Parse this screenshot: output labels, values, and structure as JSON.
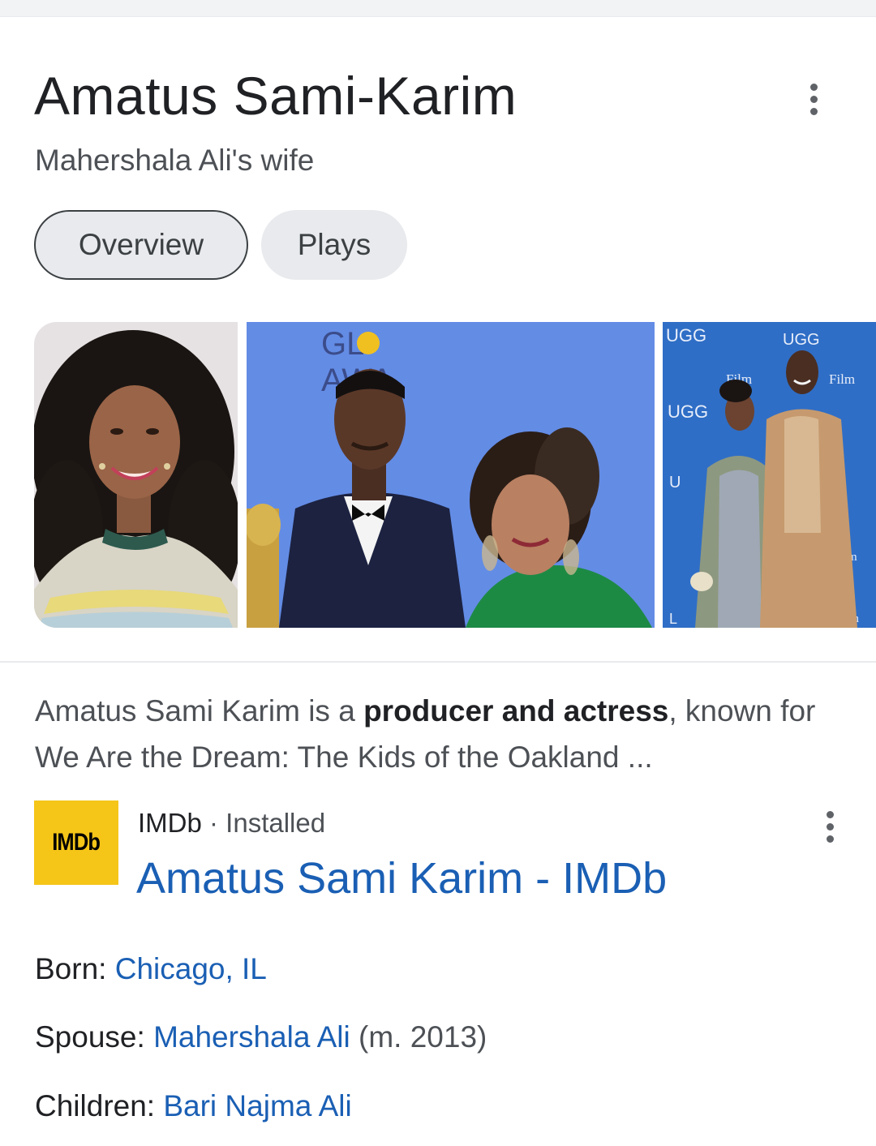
{
  "entity": {
    "title": "Amatus Sami-Karim",
    "subtitle": "Mahershala Ali's wife",
    "more_icon": "more-vert-icon"
  },
  "tabs": [
    {
      "label": "Overview",
      "selected": true
    },
    {
      "label": "Plays",
      "selected": false
    }
  ],
  "images": {
    "image2_sign": [
      "GL",
      "AWA"
    ],
    "image3_sign": [
      "UGG",
      "UGG",
      "UGG",
      "U",
      "Film",
      "Film",
      "m",
      "ilm",
      "L"
    ]
  },
  "description": {
    "before": "Amatus Sami Karim is a ",
    "bold": "producer and actress",
    "after": ", known for We Are the Dream: The Kids of the Oakland ..."
  },
  "source": {
    "logo_text": "IMDb",
    "site": "IMDb",
    "separator": " · ",
    "status": "Installed",
    "link_title": "Amatus Sami Karim - IMDb",
    "more_icon": "more-vert-icon"
  },
  "facts": [
    {
      "label": "Born: ",
      "value": "Chicago, IL",
      "extra": ""
    },
    {
      "label": "Spouse: ",
      "value": "Mahershala Ali",
      "extra": " (m. 2013)"
    },
    {
      "label": "Children: ",
      "value": "Bari Najma Ali",
      "extra": ""
    }
  ],
  "colors": {
    "link": "#1a5fb4",
    "imdb_yellow": "#f5c518",
    "chip_bg": "#e8eaed"
  }
}
